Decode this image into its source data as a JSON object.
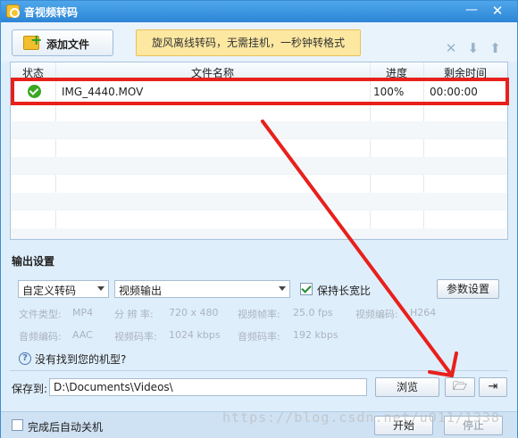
{
  "window": {
    "title": "音视频转码"
  },
  "toolbar": {
    "add_file_label": "添加文件",
    "promo_text": "旋风离线转码，无需挂机，一秒钟转格式",
    "icons": [
      "delete-icon",
      "move-down-icon",
      "move-up-icon"
    ],
    "icon_glyphs": [
      "✕",
      "⬇",
      "⬆"
    ]
  },
  "file_table": {
    "columns": [
      "状态",
      "文件名称",
      "进度",
      "剩余时间"
    ],
    "rows": [
      {
        "status": "done",
        "name": "IMG_4440.MOV",
        "progress": "100%",
        "remaining": "00:00:00"
      }
    ]
  },
  "output": {
    "section_title": "输出设置",
    "preset": "自定义转码",
    "output_type": "视频输出",
    "keep_ratio_label": "保持长宽比",
    "keep_ratio_checked": true,
    "params_button": "参数设置",
    "specs": {
      "file_type_label": "文件类型:",
      "file_type": "MP4",
      "resolution_label": "分 辨 率:",
      "resolution": "720 x 480",
      "framerate_label": "视频帧率:",
      "framerate": "25.0 fps",
      "vcodec_label": "视频编码:",
      "vcodec": "H264",
      "acodec_label": "音频编码:",
      "acodec": "AAC",
      "vbitrate_label": "视频码率:",
      "vbitrate": "1024 kbps",
      "abitrate_label": "音频码率:",
      "abitrate": "192 kbps"
    },
    "help_text": "没有找到您的机型?"
  },
  "save": {
    "label": "保存到:",
    "path": "D:\\Documents\\Videos\\",
    "browse_label": "浏览",
    "open_folder_glyph": "🗁",
    "export_glyph": "⇥"
  },
  "bottom": {
    "shutdown_label": "完成后自动关机",
    "start_label": "开始",
    "stop_label": "停止"
  },
  "watermark": "https://blog.csdn.net/u011/1338",
  "colors": {
    "highlight": "#e8201c",
    "titlebar": "#2d86d6",
    "ok": "#39a821"
  }
}
